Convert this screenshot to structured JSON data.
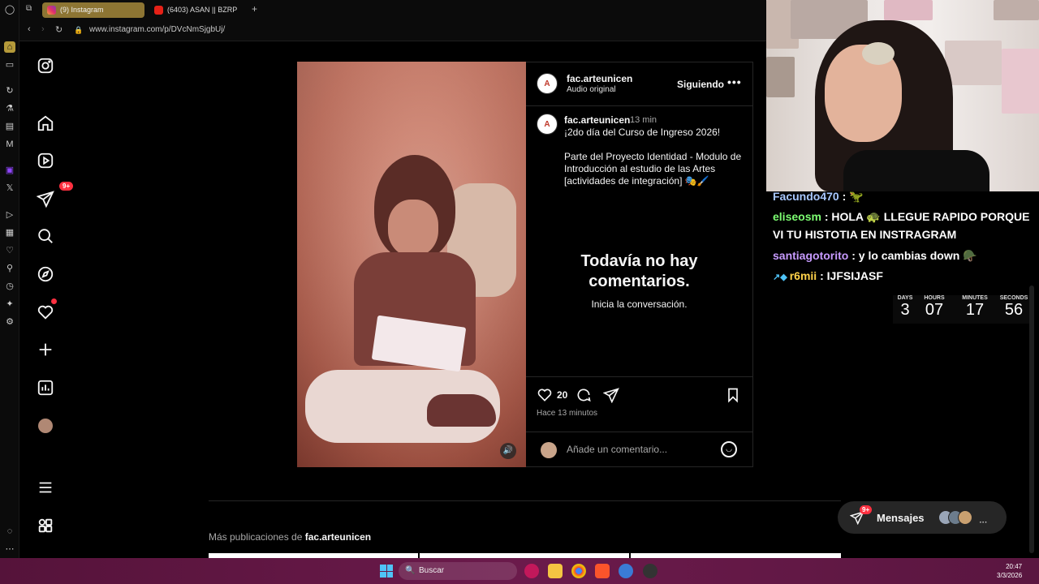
{
  "browser": {
    "tabs": [
      {
        "label": "(9) Instagram"
      },
      {
        "label": "(6403) ASAN || BZRP"
      }
    ],
    "new_tab": "+",
    "url": "www.instagram.com/p/DVcNmSjgbUj/"
  },
  "post": {
    "username": "fac.arteunicen",
    "audio": "Audio original",
    "follow_state": "Siguiendo",
    "more": "•••",
    "caption_username": "fac.arteunicen",
    "caption_time": "13 min",
    "caption_lines": [
      "¡2do día del Curso de Ingreso 2026!",
      "Parte del Proyecto Identidad - Modulo de",
      "Introducción al estudio de las Artes",
      "[actividades de integración] 🎭🖌️"
    ],
    "no_comments_title": "Todavía no hay comentarios.",
    "no_comments_sub": "Inicia la conversación.",
    "likes": "20",
    "time_ago": "Hace 13 minutos",
    "comment_placeholder": "Añade un comentario...",
    "more_posts_prefix": "Más publicaciones de ",
    "more_posts_user": "fac.arteunicen"
  },
  "nav": {
    "notifications_badge": "9+"
  },
  "chat": [
    {
      "user": "Facundo470",
      "text": " : 🦖",
      "color": "#a8c7ff"
    },
    {
      "user": "eliseosm",
      "text": " : HOLA 🐢 LLEGUE RAPIDO PORQUE VI TU HISTOTIA EN INSTRAGRAM",
      "color": "#7dff72"
    },
    {
      "user": "santiagotorito",
      "text": " : y lo cambias down 🪖",
      "color": "#c89bff"
    },
    {
      "user": "r6mii",
      "text": " : IJFSIJASF",
      "color": "#ffd24a"
    }
  ],
  "countdown": [
    {
      "label": "DAYS",
      "value": "3"
    },
    {
      "label": "HOURS",
      "value": "07"
    },
    {
      "label": "MINUTES",
      "value": "17"
    },
    {
      "label": "SECONDS",
      "value": "56"
    }
  ],
  "messages": {
    "label": "Mensajes",
    "badge": "9+"
  },
  "taskbar": {
    "search": "Buscar",
    "time": "20:47",
    "date": "3/3/2026"
  },
  "colors": {
    "instagram_bg": "#000000",
    "badge": "#ff3040",
    "taskbar": "#6b1a4b",
    "active_tab": "#8d7533"
  }
}
